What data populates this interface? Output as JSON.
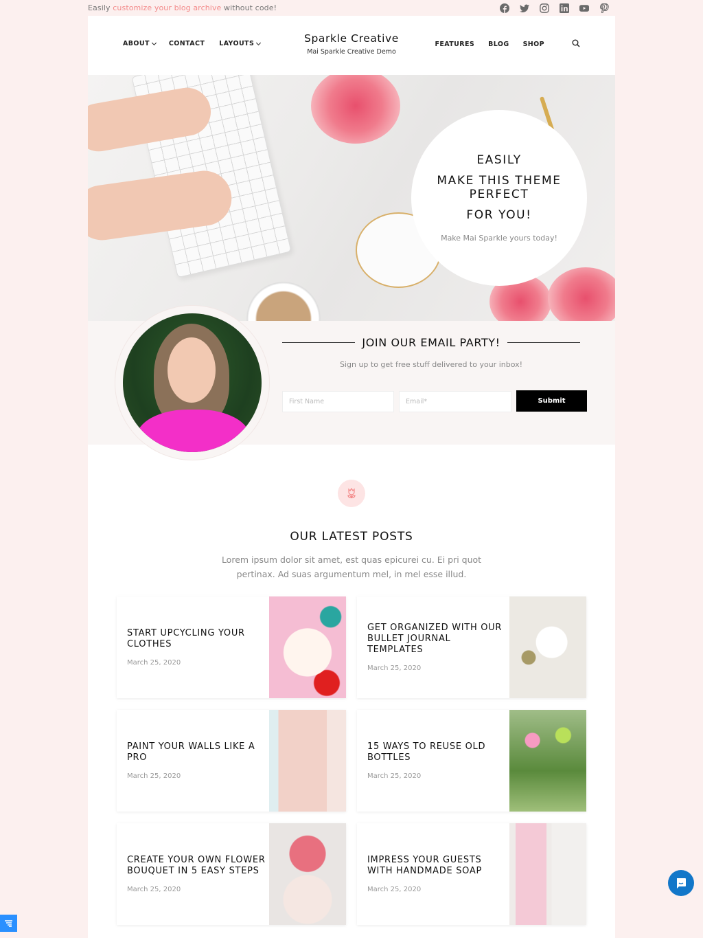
{
  "topbar": {
    "promo_prefix": "Easily",
    "promo_link": "customize your blog archive",
    "promo_suffix": "without code!",
    "link_color": "#f38a8a",
    "social_icons": [
      "facebook-icon",
      "twitter-icon",
      "instagram-icon",
      "linkedin-icon",
      "youtube-icon",
      "pinterest-icon"
    ]
  },
  "header": {
    "site_title": "Sparkle Creative",
    "tagline": "Mai Sparkle Creative Demo",
    "nav_left": [
      {
        "label": "ABOUT",
        "has_dropdown": true
      },
      {
        "label": "CONTACT",
        "has_dropdown": false
      },
      {
        "label": "LAYOUTS",
        "has_dropdown": true
      }
    ],
    "nav_right": [
      {
        "label": "FEATURES"
      },
      {
        "label": "BLOG"
      },
      {
        "label": "SHOP"
      }
    ],
    "search_icon": "search-icon"
  },
  "hero": {
    "line1": "EASILY",
    "line2": "MAKE THIS THEME",
    "line3": "PERFECT",
    "line4": "FOR YOU!",
    "subtitle": "Make Mai Sparkle yours today!"
  },
  "optin": {
    "title": "JOIN OUR EMAIL PARTY!",
    "subtitle": "Sign up to get free stuff delivered to your inbox!",
    "first_name_placeholder": "First Name",
    "email_placeholder": "Email*",
    "submit_label": "Submit"
  },
  "posts": {
    "badge_icon": "tulip-icon",
    "title": "OUR LATEST POSTS",
    "intro": "Lorem ipsum dolor sit amet, est quas epicurei cu. Ei pri quot pertinax. Ad suas argumentum mel, in mel esse illud.",
    "items": [
      {
        "title": "START UPCYCLING YOUR CLOTHES",
        "date": "March 25, 2020"
      },
      {
        "title": "GET ORGANIZED WITH OUR BULLET JOURNAL TEMPLATES",
        "date": "March 25, 2020"
      },
      {
        "title": "PAINT YOUR WALLS LIKE A PRO",
        "date": "March 25, 2020"
      },
      {
        "title": "15 WAYS TO REUSE OLD BOTTLES",
        "date": "March 25, 2020"
      },
      {
        "title": "CREATE YOUR OWN FLOWER BOUQUET IN 5 EASY STEPS",
        "date": "March 25, 2020"
      },
      {
        "title": "IMPRESS YOUR GUESTS WITH HANDMADE SOAP",
        "date": "March 25, 2020"
      }
    ]
  },
  "widgets": {
    "chat_icon": "chat-icon",
    "accessibility_icon": "menu-lines-icon"
  }
}
